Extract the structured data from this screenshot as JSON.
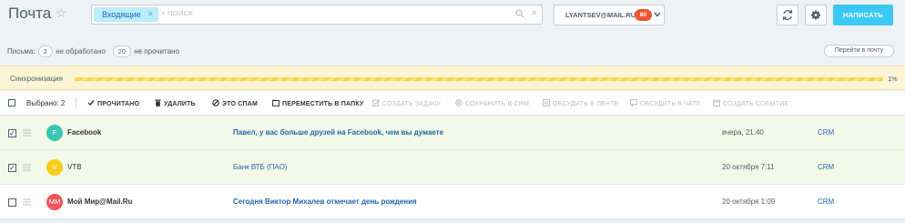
{
  "header": {
    "title": "Почта",
    "search": {
      "tag": "Входящие",
      "placeholder": "+ ПОИСК"
    },
    "account": {
      "email": "LYANTSEV@MAIL.RU",
      "badge": "80"
    },
    "write_label": "НАПИСАТЬ"
  },
  "stats": {
    "letters_label": "Письма:",
    "unprocessed_count": "2",
    "unprocessed_label": "не обработано",
    "unread_count": "20",
    "unread_label": "не прочитано",
    "goto_label": "Перейти в почту"
  },
  "sync": {
    "label": "Синхронизация",
    "percent_text": "1%",
    "progress": 0.01
  },
  "toolbar": {
    "selected_label": "Выбрано: 2",
    "actions": {
      "read": "ПРОЧИТАНО",
      "delete": "УДАЛИТЬ",
      "spam": "ЭТО СПАМ",
      "move": "ПЕРЕМЕСТИТЬ В ПАПКУ",
      "task": "СОЗДАТЬ ЗАДАЧУ",
      "crm": "СОХРАНИТЬ В CRM",
      "feed": "ОБСУДИТЬ В ЛЕНТЕ",
      "chat": "ОБСУДИТЬ В ЧАТЕ",
      "event": "СОЗДАТЬ СОБЫТИЕ"
    }
  },
  "messages": [
    {
      "checked": "✓",
      "initials": "F",
      "avatar_color": "#3ac6b3",
      "sender": "Facebook",
      "subject": "Павел, у вас больше друзей на Facebook, чем вы думаете",
      "date": "вчера, 21:40",
      "crm": "CRM"
    },
    {
      "checked": "✓",
      "initials": "V",
      "avatar_color": "#f6cd1b",
      "sender": "VTB",
      "subject": "Банк ВТБ (ПАО)",
      "date": "20 октября 7:11",
      "crm": "CRM"
    },
    {
      "checked": "",
      "initials": "ММ",
      "avatar_color": "#f0555a",
      "sender": "Мой Мир@Mail.Ru",
      "subject": "Сегодня Виктор Михалев отмечает день рождения",
      "date": "20 октября 1:09",
      "crm": "CRM"
    }
  ]
}
